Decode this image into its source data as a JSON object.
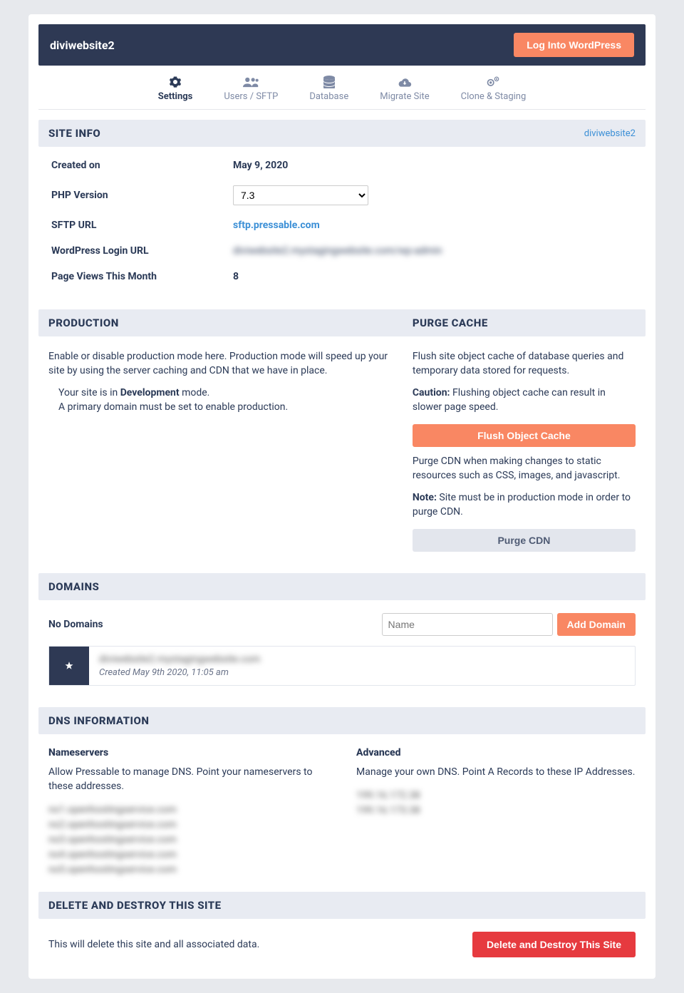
{
  "header": {
    "site_name": "diviwebsite2",
    "login_btn": "Log Into WordPress"
  },
  "tabs": [
    {
      "label": "Settings",
      "icon": "gear",
      "active": true
    },
    {
      "label": "Users / SFTP",
      "icon": "users",
      "active": false
    },
    {
      "label": "Database",
      "icon": "database",
      "active": false
    },
    {
      "label": "Migrate Site",
      "icon": "cloud-down",
      "active": false
    },
    {
      "label": "Clone & Staging",
      "icon": "gears",
      "active": false
    }
  ],
  "site_info": {
    "heading": "SITE INFO",
    "link": "diviwebsite2",
    "rows": {
      "created_label": "Created on",
      "created_value": "May 9, 2020",
      "php_label": "PHP Version",
      "php_value": "7.3",
      "sftp_label": "SFTP URL",
      "sftp_value": "sftp.pressable.com",
      "wp_login_label": "WordPress Login URL",
      "wp_login_value": "diviwebsite2.mystagingwebsite.com/wp-admin",
      "views_label": "Page Views This Month",
      "views_value": "8"
    }
  },
  "prod_cache": {
    "prod_heading": "PRODUCTION",
    "cache_heading": "PURGE CACHE",
    "prod_desc": "Enable or disable production mode here. Production mode will speed up your site by using the server caching and CDN that we have in place.",
    "dev_mode_1a": "Your site is in ",
    "dev_mode_bold": "Development",
    "dev_mode_1b": " mode.",
    "dev_mode_2": "A primary domain must be set to enable production.",
    "cache_desc": "Flush site object cache of database queries and temporary data stored for requests.",
    "cache_caution_bold": "Caution:",
    "cache_caution_rest": " Flushing object cache can result in slower page speed.",
    "flush_btn": "Flush Object Cache",
    "cdn_desc": "Purge CDN when making changes to static resources such as CSS, images, and javascript.",
    "cdn_note_bold": "Note:",
    "cdn_note_rest": " Site must be in production mode in order to purge CDN.",
    "purge_btn": "Purge CDN"
  },
  "domains": {
    "heading": "DOMAINS",
    "none": "No Domains",
    "placeholder": "Name",
    "add_btn": "Add Domain",
    "row": {
      "name": "diviwebsite2.mystagingwebsite.com",
      "meta": "Created May 9th 2020, 11:05 am"
    }
  },
  "dns": {
    "heading": "DNS INFORMATION",
    "ns_head": "Nameservers",
    "ns_desc": "Allow Pressable to manage DNS. Point your nameservers to these addresses.",
    "ns_list": [
      "ns1.openhostingservice.com",
      "ns2.openhostingservice.com",
      "ns3.openhostingservice.com",
      "ns4.openhostingservice.com",
      "ns5.openhostingservice.com"
    ],
    "adv_head": "Advanced",
    "adv_desc": "Manage your own DNS. Point A Records to these IP Addresses.",
    "ip_list": [
      "199.16.172.38",
      "199.16.173.38"
    ]
  },
  "delete": {
    "heading": "DELETE AND DESTROY THIS SITE",
    "desc": "This will delete this site and all associated data.",
    "btn": "Delete and Destroy This Site"
  }
}
